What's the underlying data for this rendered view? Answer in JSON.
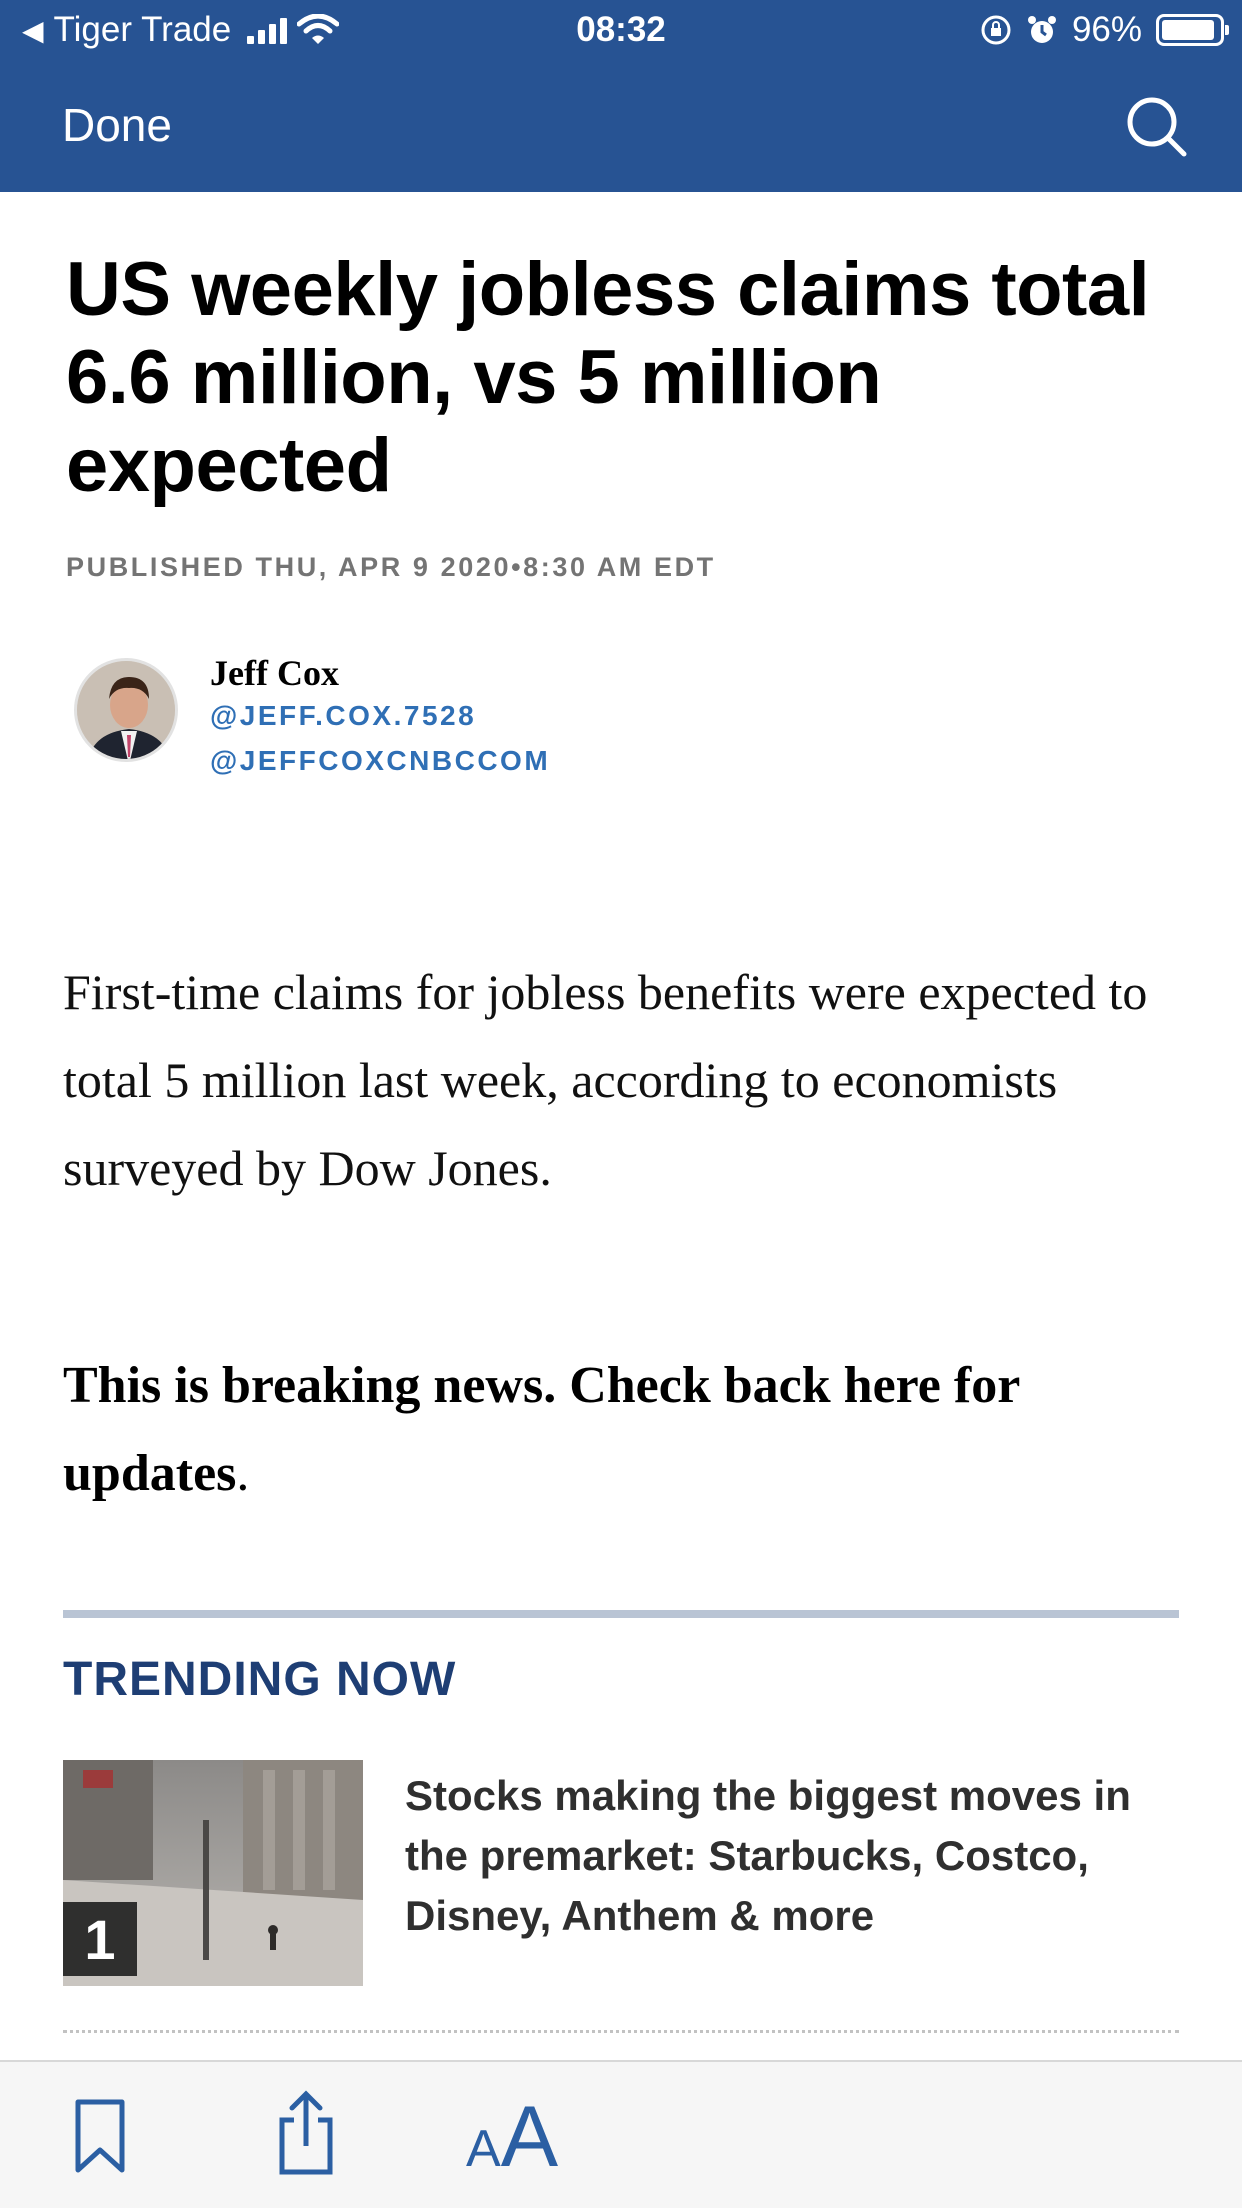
{
  "status_bar": {
    "back_app": "Tiger Trade",
    "time": "08:32",
    "battery": "96%"
  },
  "nav": {
    "done_label": "Done",
    "search_icon": "search-icon"
  },
  "article": {
    "headline": "US weekly jobless claims total 6.6 million, vs 5 million expected",
    "published": "PUBLISHED THU, APR 9 2020•8:30 AM EDT",
    "author": {
      "name": "Jeff Cox",
      "handles": [
        "@JEFF.COX.7528",
        "@JEFFCOXCNBCCOM"
      ]
    },
    "body": "First-time claims for jobless benefits were expected to total 5 million last week, according to economists surveyed by Dow Jones.",
    "breaking_bold": "This is breaking news. Check back here for updates",
    "breaking_period": "."
  },
  "trending": {
    "title": "TRENDING NOW",
    "items": [
      {
        "rank": "1",
        "headline": "Stocks making the biggest moves in the premarket: Starbucks, Costco, Disney, Anthem & more"
      }
    ]
  },
  "toolbar": {
    "bookmark_icon": "bookmark-icon",
    "share_icon": "share-icon",
    "text_size_small": "A",
    "text_size_large": "A"
  },
  "colors": {
    "nav_bar": "#275393",
    "link_blue": "#2f6fb5",
    "trending_blue": "#1e3e74",
    "toolbar_blue": "#2b5fa3"
  }
}
